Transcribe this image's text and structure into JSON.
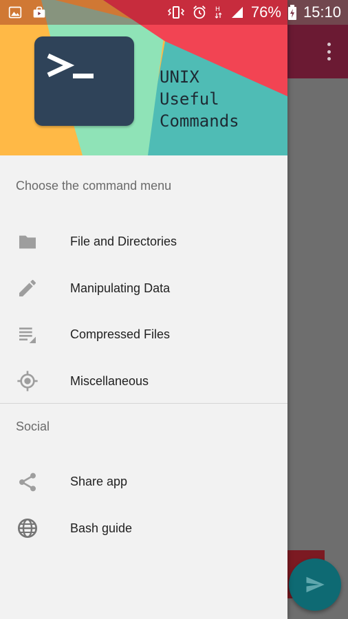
{
  "status_bar": {
    "battery_percent": "76%",
    "time": "15:10",
    "left_icons": [
      "image-icon",
      "shopping-bag-icon"
    ],
    "right_icons": [
      "vibrate-icon",
      "alarm-icon",
      "hplus-icon",
      "signal-icon",
      "battery-icon"
    ]
  },
  "drawer": {
    "header": {
      "title_lines": [
        "UNIX",
        "Useful",
        "Commands"
      ],
      "logo_symbol": ">_",
      "colors": {
        "yellow": "#ffb946",
        "mint": "#8fe3b7",
        "teal": "#4fbcb5",
        "red": "#f24453",
        "logo_bg": "#2f4359"
      }
    },
    "sections": [
      {
        "title": "Choose the command menu",
        "items": [
          {
            "label": "File and Directories",
            "icon": "folder-icon"
          },
          {
            "label": "Manipulating Data",
            "icon": "pencil-icon"
          },
          {
            "label": "Compressed Files",
            "icon": "compress-icon"
          },
          {
            "label": "Miscellaneous",
            "icon": "crosshair-icon"
          }
        ]
      },
      {
        "title": "Social",
        "items": [
          {
            "label": "Share app",
            "icon": "share-icon"
          },
          {
            "label": "Bash guide",
            "icon": "globe-icon"
          }
        ]
      }
    ]
  },
  "background_app": {
    "toolbar_color": "#6b1a33",
    "fab_icon": "send-icon",
    "fab_color": "#0e6a73"
  }
}
